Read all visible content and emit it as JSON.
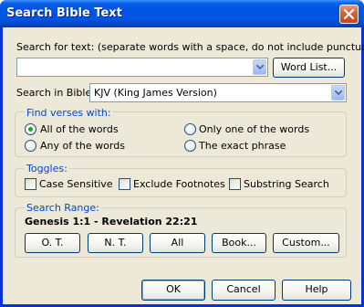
{
  "window": {
    "title": "Search Bible Text",
    "close_icon": "close-icon"
  },
  "search": {
    "label": "Search for text:  (separate words with a space, do not include punctuation)",
    "value": "",
    "word_list_button": "Word List..."
  },
  "bible": {
    "label": "Search in Bible:",
    "selected": "KJV (King James Version)"
  },
  "find_verses": {
    "title": "Find verses with:",
    "options": [
      {
        "label": "All of the words",
        "selected": true
      },
      {
        "label": "Only one of the words",
        "selected": false
      },
      {
        "label": "Any of the words",
        "selected": false
      },
      {
        "label": "The exact phrase",
        "selected": false
      }
    ]
  },
  "toggles": {
    "title": "Toggles:",
    "items": [
      {
        "label": "Case Sensitive",
        "checked": false
      },
      {
        "label": "Exclude Footnotes",
        "checked": false
      },
      {
        "label": "Substring Search",
        "checked": false
      }
    ]
  },
  "range": {
    "title": "Search Range:",
    "value": "Genesis 1:1 - Revelation 22:21",
    "buttons": [
      "O. T.",
      "N. T.",
      "All",
      "Book...",
      "Custom..."
    ]
  },
  "footer": {
    "ok": "OK",
    "cancel": "Cancel",
    "help": "Help"
  },
  "colors": {
    "titlebar": "#0054e3",
    "dialog_bg": "#ece9d8",
    "group_title": "#0046d5",
    "radio_dot": "#21a121"
  }
}
